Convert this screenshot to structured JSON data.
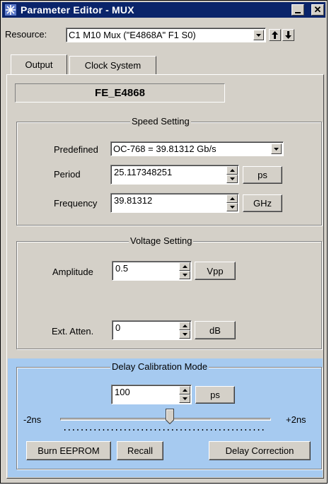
{
  "window": {
    "title": "Parameter Editor - MUX",
    "title_bar_color": "#0a246a",
    "icon": "keysight-star-icon"
  },
  "resource": {
    "label": "Resource:",
    "value": "C1 M10 Mux (\"E4868A\" F1 S0)"
  },
  "tabs": [
    {
      "label": "Output",
      "active": true
    },
    {
      "label": "Clock System",
      "active": false
    }
  ],
  "device_name": "FE_E4868",
  "speed_setting": {
    "title": "Speed Setting",
    "predefined_label": "Predefined",
    "predefined_value": "OC-768 = 39.81312 Gb/s",
    "period_label": "Period",
    "period_value": "25.117348251",
    "period_unit": "ps",
    "frequency_label": "Frequency",
    "frequency_value": "39.81312",
    "frequency_unit": "GHz"
  },
  "voltage_setting": {
    "title": "Voltage Setting",
    "amplitude_label": "Amplitude",
    "amplitude_value": "0.5",
    "amplitude_unit": "Vpp",
    "atten_label": "Ext. Atten.",
    "atten_value": "0",
    "atten_unit": "dB"
  },
  "delay_calibration": {
    "title": "Delay Calibration Mode",
    "background_color": "#a6caf0",
    "delay_value": "100",
    "delay_unit": "ps",
    "min_label": "-2ns",
    "max_label": "+2ns",
    "slider_level": 0.52,
    "burn_label": "Burn EEPROM",
    "recall_label": "Recall",
    "correction_label": "Delay Correction"
  }
}
